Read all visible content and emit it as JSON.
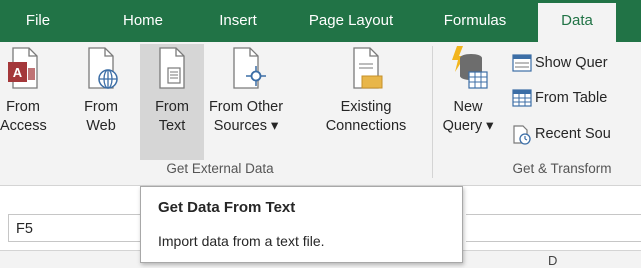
{
  "tabs": [
    {
      "label": "File"
    },
    {
      "label": "Home"
    },
    {
      "label": "Insert"
    },
    {
      "label": "Page Layout"
    },
    {
      "label": "Formulas"
    },
    {
      "label": "Data"
    }
  ],
  "get_external_data": {
    "group_label": "Get External Data",
    "from_access": {
      "line1": "From",
      "line2": "Access"
    },
    "from_web": {
      "line1": "From",
      "line2": "Web"
    },
    "from_text": {
      "line1": "From",
      "line2": "Text"
    },
    "from_other": {
      "line1": "From Other",
      "line2": "Sources ▾"
    },
    "existing": {
      "line1": "Existing",
      "line2": "Connections"
    }
  },
  "get_transform": {
    "group_label": "Get & Transform",
    "new_query": {
      "line1": "New",
      "line2": "Query ▾"
    },
    "show_queries": "Show Quer",
    "from_table": "From Table",
    "recent_sources": "Recent Sou"
  },
  "name_box": {
    "value": "F5"
  },
  "tooltip": {
    "title": "Get Data From Text",
    "description": "Import data from a text file."
  },
  "column_header_fragment": "D",
  "colors": {
    "ribbon_green": "#217346",
    "ribbon_bg": "#f3f3f3",
    "hover": "#d6d6d6"
  }
}
